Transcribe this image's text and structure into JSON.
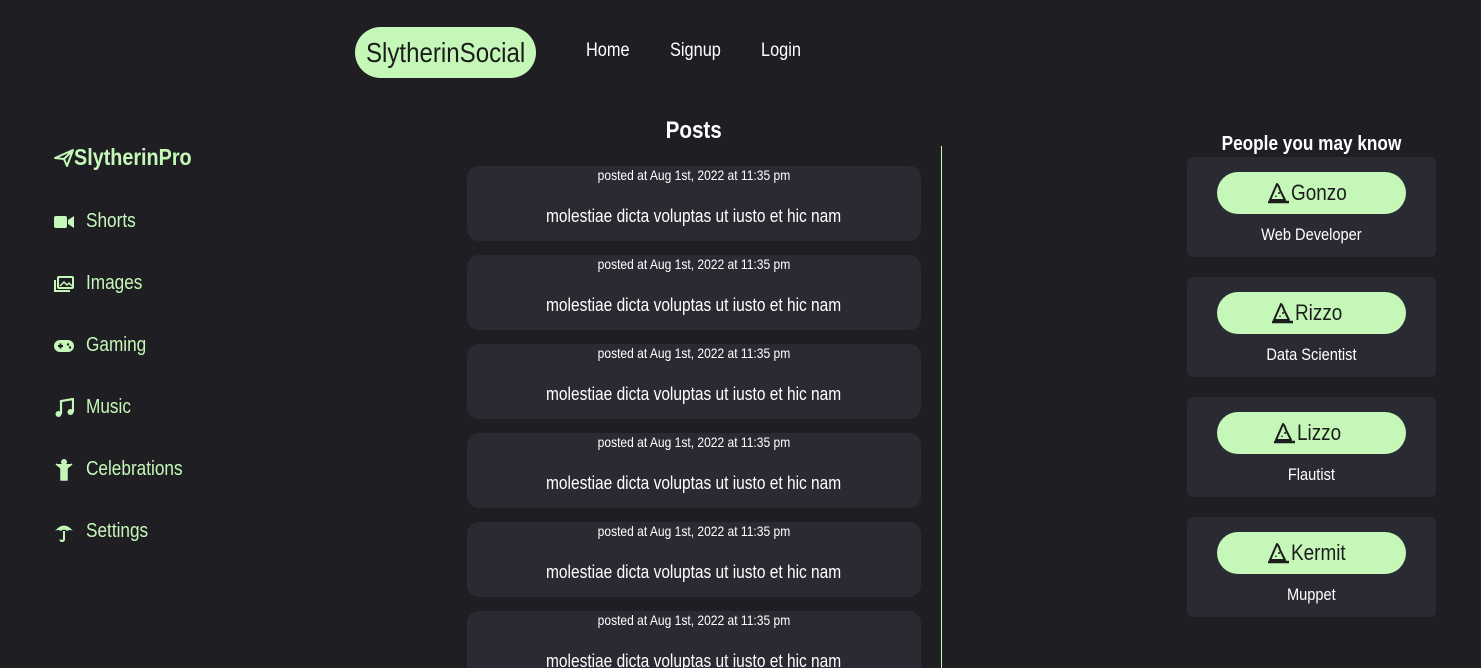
{
  "header": {
    "brand": "SlytherinSocial",
    "nav": [
      "Home",
      "Signup",
      "Login"
    ]
  },
  "sidebar": {
    "title": "SlytherinPro",
    "title_icon": "paper-plane-icon",
    "items": [
      {
        "label": "Shorts",
        "icon": "video-camera-icon"
      },
      {
        "label": "Images",
        "icon": "images-icon"
      },
      {
        "label": "Gaming",
        "icon": "gamepad-icon"
      },
      {
        "label": "Music",
        "icon": "music-note-icon"
      },
      {
        "label": "Celebrations",
        "icon": "child-icon"
      },
      {
        "label": "Settings",
        "icon": "umbrella-icon"
      }
    ]
  },
  "posts": {
    "heading": "Posts",
    "items": [
      {
        "meta": "posted at Aug 1st, 2022 at 11:35 pm",
        "text": "molestiae dicta voluptas ut iusto et hic nam"
      },
      {
        "meta": "posted at Aug 1st, 2022 at 11:35 pm",
        "text": "molestiae dicta voluptas ut iusto et hic nam"
      },
      {
        "meta": "posted at Aug 1st, 2022 at 11:35 pm",
        "text": "molestiae dicta voluptas ut iusto et hic nam"
      },
      {
        "meta": "posted at Aug 1st, 2022 at 11:35 pm",
        "text": "molestiae dicta voluptas ut iusto et hic nam"
      },
      {
        "meta": "posted at Aug 1st, 2022 at 11:35 pm",
        "text": "molestiae dicta voluptas ut iusto et hic nam"
      },
      {
        "meta": "posted at Aug 1st, 2022 at 11:35 pm",
        "text": "molestiae dicta voluptas ut iusto et hic nam"
      }
    ]
  },
  "people": {
    "heading": "People you may know",
    "items": [
      {
        "name": "Gonzo",
        "role": "Web Developer",
        "icon": "wizard-hat-icon"
      },
      {
        "name": "Rizzo",
        "role": "Data Scientist",
        "icon": "wizard-hat-icon"
      },
      {
        "name": "Lizzo",
        "role": "Flautist",
        "icon": "wizard-hat-icon"
      },
      {
        "name": "Kermit",
        "role": "Muppet",
        "icon": "wizard-hat-icon"
      }
    ]
  },
  "colors": {
    "accent": "#c5f8b8",
    "background": "#1e1e23",
    "card": "#2a2a33",
    "text": "#ffffff"
  }
}
